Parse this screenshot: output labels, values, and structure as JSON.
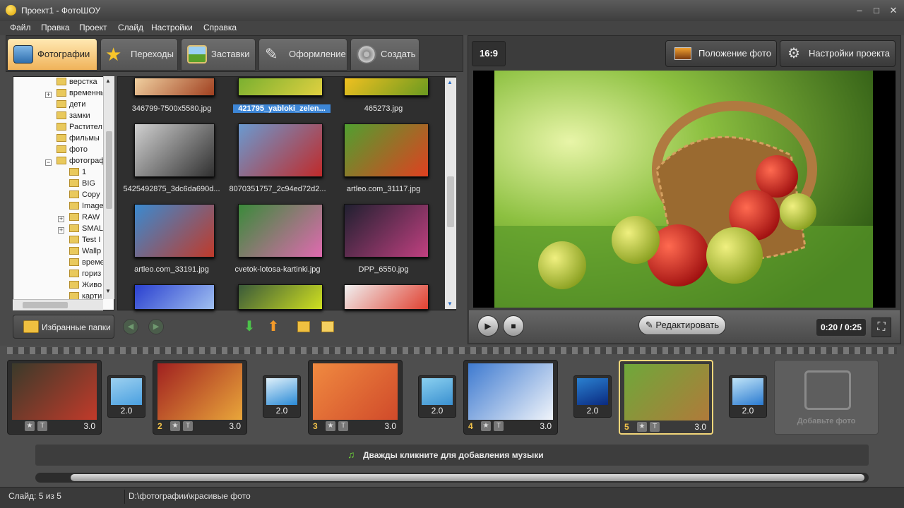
{
  "window": {
    "title": "Проект1 - ФотоШОУ",
    "controls": [
      "–",
      "□",
      "✕"
    ]
  },
  "menu": [
    "Файл",
    "Правка",
    "Проект",
    "Слайд",
    "Настройки",
    "Справка"
  ],
  "tabs": [
    {
      "label": "Фотографии",
      "icon": "photo-camera-icon",
      "active": true
    },
    {
      "label": "Переходы",
      "icon": "star-icon"
    },
    {
      "label": "Заставки",
      "icon": "picture-icon"
    },
    {
      "label": "Оформление",
      "icon": "brush-icon"
    },
    {
      "label": "Создать",
      "icon": "film-reel-icon"
    }
  ],
  "tree": [
    {
      "label": "верстка",
      "level": 1
    },
    {
      "label": "временны",
      "level": 1,
      "expander": "+"
    },
    {
      "label": "дети",
      "level": 1
    },
    {
      "label": "замки",
      "level": 1
    },
    {
      "label": "Растител",
      "level": 1
    },
    {
      "label": "фильмы",
      "level": 1
    },
    {
      "label": "фото",
      "level": 1
    },
    {
      "label": "фотограф",
      "level": 1,
      "expander": "−"
    },
    {
      "label": "1",
      "level": 2
    },
    {
      "label": "BIG",
      "level": 2
    },
    {
      "label": "Copy",
      "level": 2
    },
    {
      "label": "Image",
      "level": 2
    },
    {
      "label": "RAW",
      "level": 2,
      "expander": "+"
    },
    {
      "label": "SMAL",
      "level": 2,
      "expander": "+"
    },
    {
      "label": "Test I",
      "level": 2
    },
    {
      "label": "Wallp",
      "level": 2
    },
    {
      "label": "време",
      "level": 2
    },
    {
      "label": "гориз",
      "level": 2
    },
    {
      "label": "Живо",
      "level": 2
    },
    {
      "label": "карти",
      "level": 2
    }
  ],
  "thumbnails": [
    {
      "caption": "346799-7500x5580.jpg",
      "selected": false
    },
    {
      "caption": "421795_yabloki_zelen...",
      "selected": true
    },
    {
      "caption": "465273.jpg",
      "selected": false
    },
    {
      "caption": "5425492875_3dc6da690d...",
      "selected": false
    },
    {
      "caption": "8070351757_2c94ed72d2...",
      "selected": false
    },
    {
      "caption": "artleo.com_31117.jpg",
      "selected": false
    },
    {
      "caption": "artleo.com_33191.jpg",
      "selected": false
    },
    {
      "caption": "cvetok-lotosa-kartinki.jpg",
      "selected": false
    },
    {
      "caption": "DPP_6550.jpg",
      "selected": false
    }
  ],
  "favorites_button": "Избранные папки",
  "preview": {
    "ratio": "16:9",
    "photo_position_btn": "Положение фото",
    "project_settings_btn": "Настройки проекта",
    "edit_btn": "Редактировать",
    "time": "0:20 / 0:25"
  },
  "slides": [
    {
      "num": "",
      "duration": "3.0",
      "colors": [
        "#3a3a2a",
        "#c23a2a"
      ]
    },
    {
      "num": "2",
      "duration": "3.0",
      "colors": [
        "#a02020",
        "#e9a63a"
      ]
    },
    {
      "num": "3",
      "duration": "3.0",
      "colors": [
        "#f08a40",
        "#d04a2a"
      ]
    },
    {
      "num": "4",
      "duration": "3.0",
      "colors": [
        "#3e7ad0",
        "#f0f4fa"
      ]
    },
    {
      "num": "5",
      "duration": "3.0",
      "colors": [
        "#6ea83a",
        "#b07a3a"
      ],
      "selected": true
    }
  ],
  "transitions": [
    {
      "duration": "2.0",
      "colors": [
        "#9cd0f0",
        "#4aa0e0"
      ]
    },
    {
      "duration": "2.0",
      "colors": [
        "#dff0fa",
        "#2a8ad6"
      ]
    },
    {
      "duration": "2.0",
      "colors": [
        "#8ad0f0",
        "#3a90d0"
      ]
    },
    {
      "duration": "2.0",
      "colors": [
        "#2a80d0",
        "#0a2a80"
      ]
    },
    {
      "duration": "2.0",
      "colors": [
        "#c0e4f8",
        "#2a7ad0"
      ]
    }
  ],
  "add_photo": "Добавьте фото",
  "music_hint": "Дважды кликните для добавления музыки",
  "status": {
    "slide": "Слайд: 5 из 5",
    "path": "D:\\фотографии\\красивые фото"
  }
}
